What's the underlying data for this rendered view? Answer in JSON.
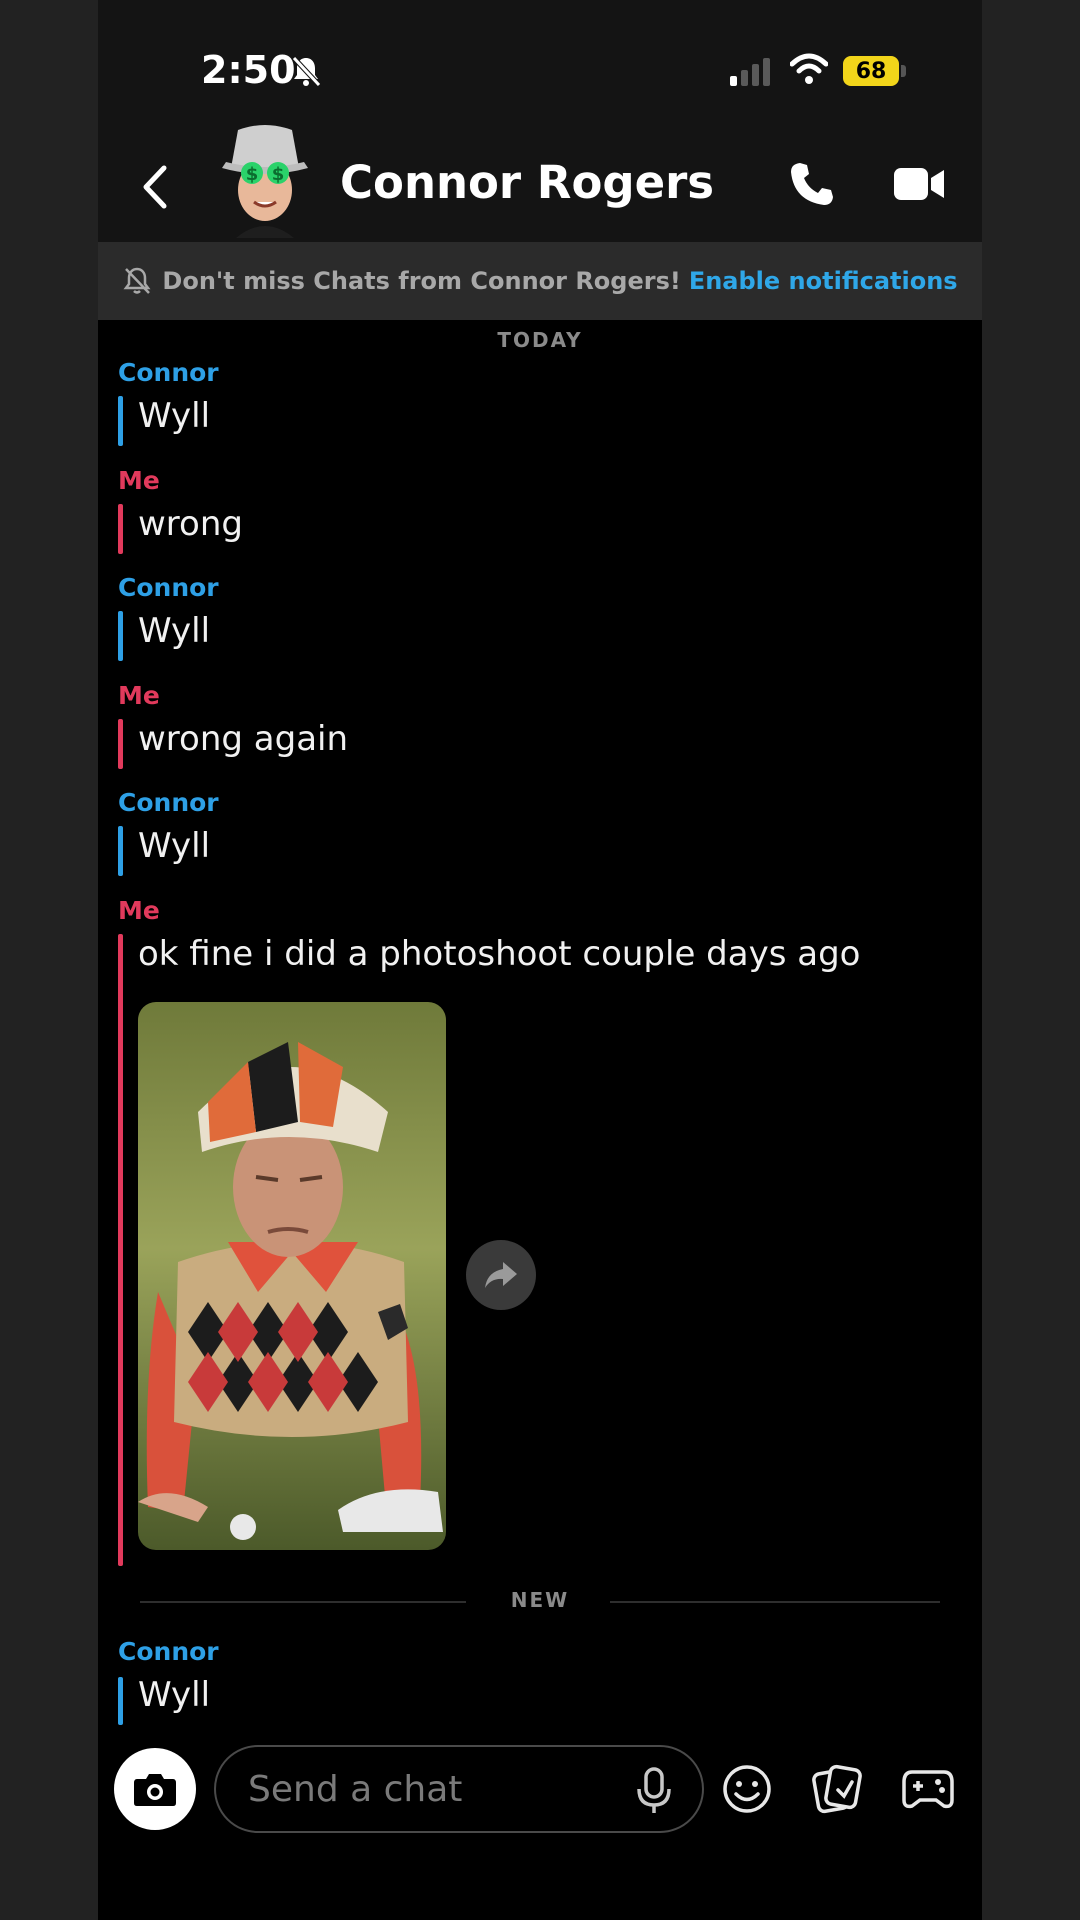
{
  "status_bar": {
    "time": "2:50",
    "battery": "68"
  },
  "header": {
    "contact_name": "Connor Rogers"
  },
  "notification_banner": {
    "text": "Don't miss Chats from Connor Rogers!",
    "link": "Enable notifications"
  },
  "chat": {
    "day_label": "TODAY",
    "new_label": "NEW",
    "messages": [
      {
        "sender": "Connor",
        "text": "Wyll"
      },
      {
        "sender": "Me",
        "text": "wrong"
      },
      {
        "sender": "Connor",
        "text": "Wyll"
      },
      {
        "sender": "Me",
        "text": "wrong again"
      },
      {
        "sender": "Connor",
        "text": "Wyll"
      },
      {
        "sender": "Me",
        "text": "ok fine i did a photoshoot couple days ago"
      },
      {
        "sender": "Connor",
        "text": "Wyll"
      }
    ]
  },
  "input_bar": {
    "placeholder": "Send a chat"
  },
  "colors": {
    "connor": "#2ea0e6",
    "me": "#e23a5c",
    "link": "#2fa7e8",
    "battery": "#f2d51a"
  },
  "icons": [
    "bell-off-icon",
    "signal-icon",
    "wifi-icon",
    "back-chevron-icon",
    "phone-icon",
    "video-camera-icon",
    "camera-icon",
    "microphone-icon",
    "emoji-icon",
    "sticker-icon",
    "game-controller-icon",
    "share-arrow-icon"
  ]
}
